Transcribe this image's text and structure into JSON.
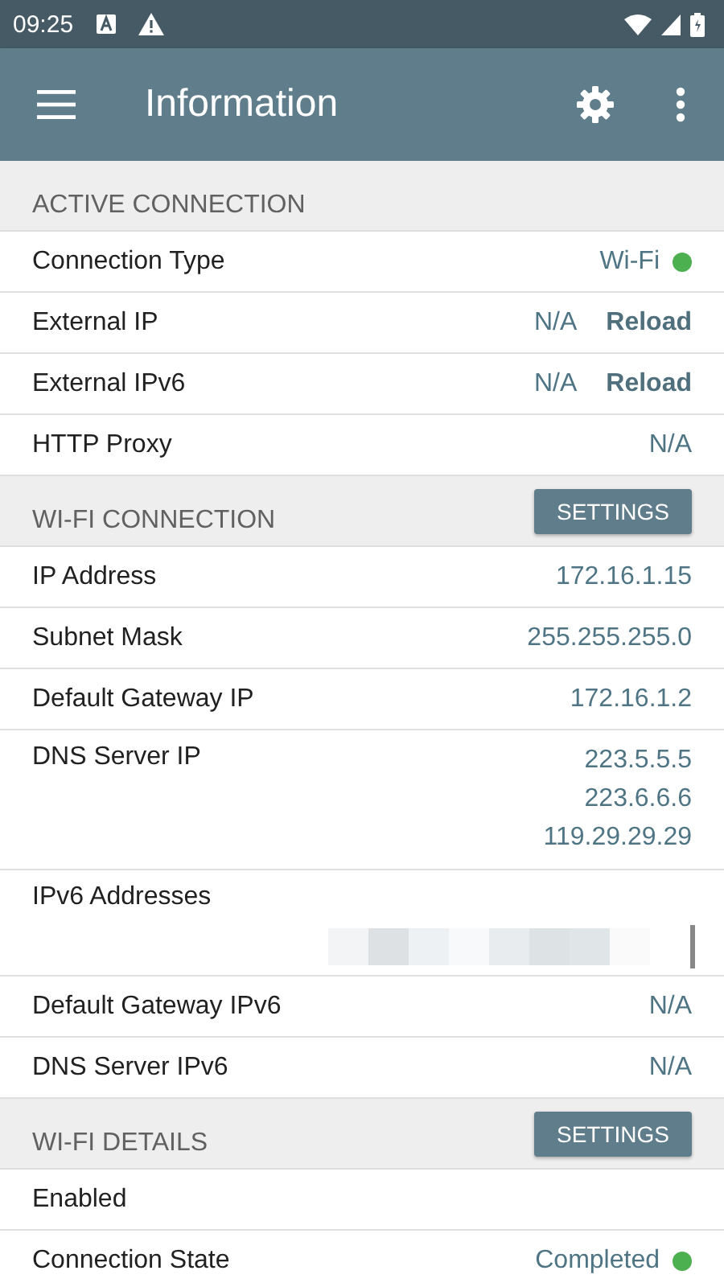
{
  "status_bar": {
    "time": "09:25"
  },
  "app_bar": {
    "title": "Information"
  },
  "sections": [
    {
      "title": "ACTIVE CONNECTION",
      "rows": [
        {
          "kind": "text",
          "label": "Connection Type",
          "value": "Wi-Fi",
          "color": "#4caf50"
        },
        {
          "kind": "text",
          "label": "External IP",
          "value": "N/A",
          "action": "Reload"
        },
        {
          "kind": "text",
          "label": "External IPv6",
          "value": "N/A",
          "action": "Reload"
        },
        {
          "kind": "text",
          "label": "HTTP Proxy",
          "value": "N/A"
        }
      ]
    },
    {
      "title": "WI-FI CONNECTION",
      "button": "SETTINGS",
      "rows": [
        {
          "kind": "text",
          "label": "IP Address",
          "value": "172.16.1.15"
        },
        {
          "kind": "text",
          "label": "Subnet Mask",
          "value": "255.255.255.0"
        },
        {
          "kind": "text",
          "label": "Default Gateway IP",
          "value": "172.16.1.2"
        },
        {
          "kind": "multi",
          "label": "DNS Server IP",
          "values": [
            "223.5.5.5",
            "223.6.6.6",
            "119.29.29.29"
          ]
        },
        {
          "kind": "redacted",
          "label": "IPv6 Addresses"
        },
        {
          "kind": "text",
          "label": "Default Gateway IPv6",
          "value": "N/A"
        },
        {
          "kind": "text",
          "label": "DNS Server IPv6",
          "value": "N/A"
        }
      ]
    },
    {
      "title": "WI-FI DETAILS",
      "button": "SETTINGS",
      "rows": [
        {
          "kind": "text",
          "label": "Enabled"
        },
        {
          "kind": "text",
          "label": "Connection State",
          "value": "Completed",
          "color": "#4caf50"
        }
      ]
    }
  ]
}
